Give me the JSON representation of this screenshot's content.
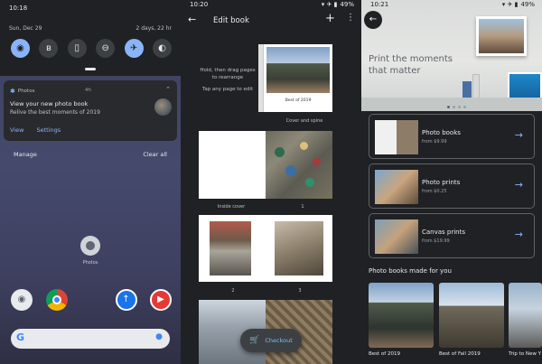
{
  "panel1": {
    "status_time": "10:18",
    "date": "Sun, Dec 29",
    "battery_text": "2 days, 22 hr",
    "quick_tiles": [
      {
        "icon": "wifi-icon",
        "glyph": "◉",
        "active": true
      },
      {
        "icon": "bluetooth-icon",
        "glyph": "ʙ",
        "active": false
      },
      {
        "icon": "flashlight-icon",
        "glyph": "▯",
        "active": false
      },
      {
        "icon": "do-not-disturb-icon",
        "glyph": "⊖",
        "active": false
      },
      {
        "icon": "airplane-mode-icon",
        "glyph": "✈",
        "active": true
      },
      {
        "icon": "battery-saver-icon",
        "glyph": "◐",
        "active": false
      }
    ],
    "notification": {
      "app": "Photos",
      "time": "4h",
      "title": "View your new photo book",
      "text": "Relive the best moments of 2019",
      "actions": [
        "View",
        "Settings"
      ]
    },
    "manage": "Manage",
    "clear_all": "Clear all",
    "home_icon_label": "Photos",
    "search_logo": "G",
    "search_mic": "●"
  },
  "panel2": {
    "status_time": "10:20",
    "battery": "49%",
    "title": "Edit book",
    "hint": "Hold, then drag pages to rearrange",
    "hint2": "Tap any page to edit",
    "cover_caption": "Best of 2019",
    "cover_label": "Cover and spine",
    "inside_cover_label": "Inside cover",
    "page_labels": [
      "1",
      "2",
      "3"
    ],
    "checkout": "Checkout"
  },
  "panel3": {
    "status_time": "10:21",
    "battery": "49%",
    "hero_title": "Print the moments that matter",
    "products": [
      {
        "title": "Photo books",
        "price": "from $9.99"
      },
      {
        "title": "Photo prints",
        "price": "from $0.25"
      },
      {
        "title": "Canvas prints",
        "price": "from $19.99"
      }
    ],
    "section_title": "Photo books made for you",
    "recommendations": [
      "Best of 2019",
      "Best of Fall 2019",
      "Trip to New Y"
    ]
  },
  "icons": {
    "back": "←",
    "add": "+",
    "more": "⋮",
    "arrow": "→",
    "cart": "🛒",
    "expand": "⌃",
    "status_icons": "▾ ✈ ▮"
  }
}
